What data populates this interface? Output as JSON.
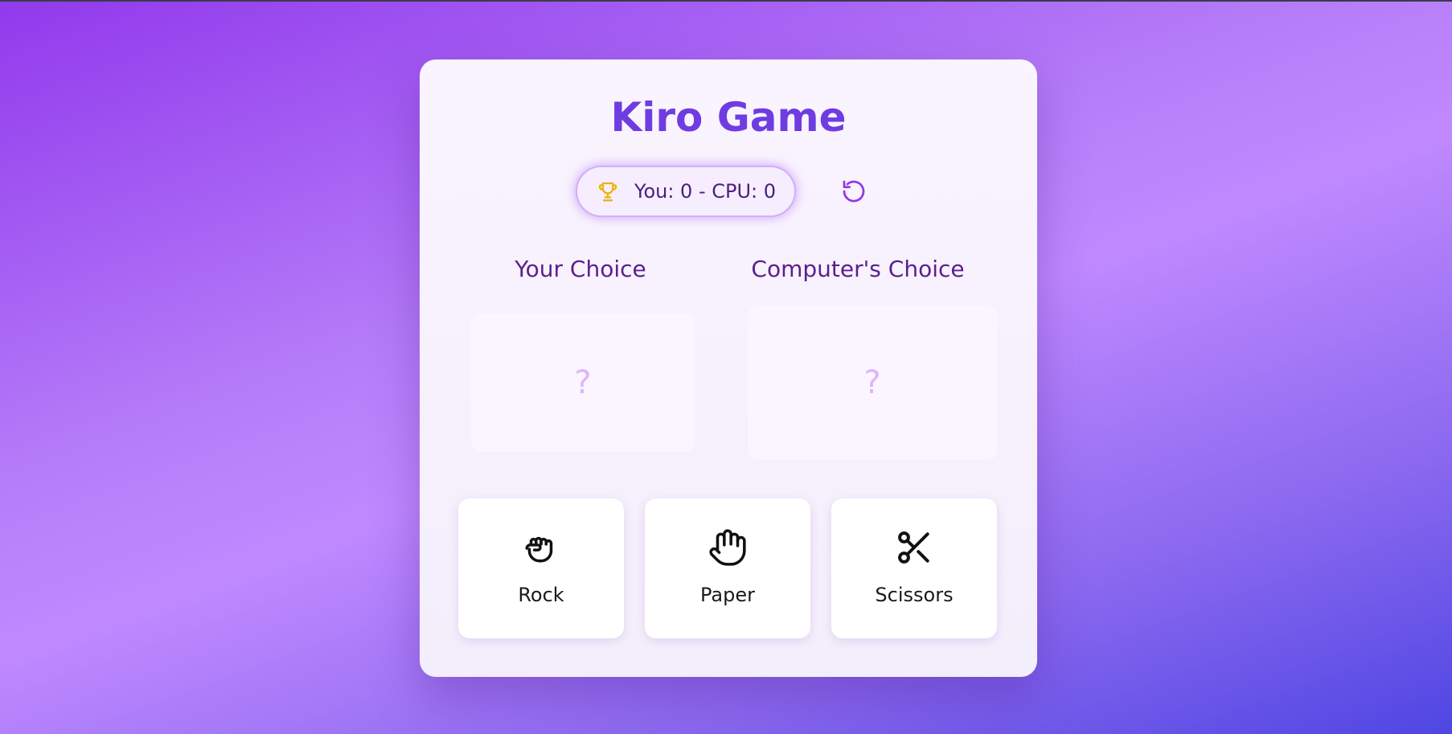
{
  "game": {
    "title": "Kiro Game",
    "score_text": "You: 0 - CPU: 0"
  },
  "choices": {
    "your_label": "Your Choice",
    "cpu_label": "Computer's Choice",
    "your_value": "?",
    "cpu_value": "?"
  },
  "moves": [
    {
      "label": "Rock",
      "icon": "rock-fist-icon"
    },
    {
      "label": "Paper",
      "icon": "paper-hand-icon"
    },
    {
      "label": "Scissors",
      "icon": "scissors-icon"
    }
  ],
  "icons": {
    "score": "trophy-icon",
    "reset": "reset-icon"
  },
  "colors": {
    "accent": "#6f3ce2",
    "trophy": "#eab308",
    "reset": "#9333ea"
  }
}
